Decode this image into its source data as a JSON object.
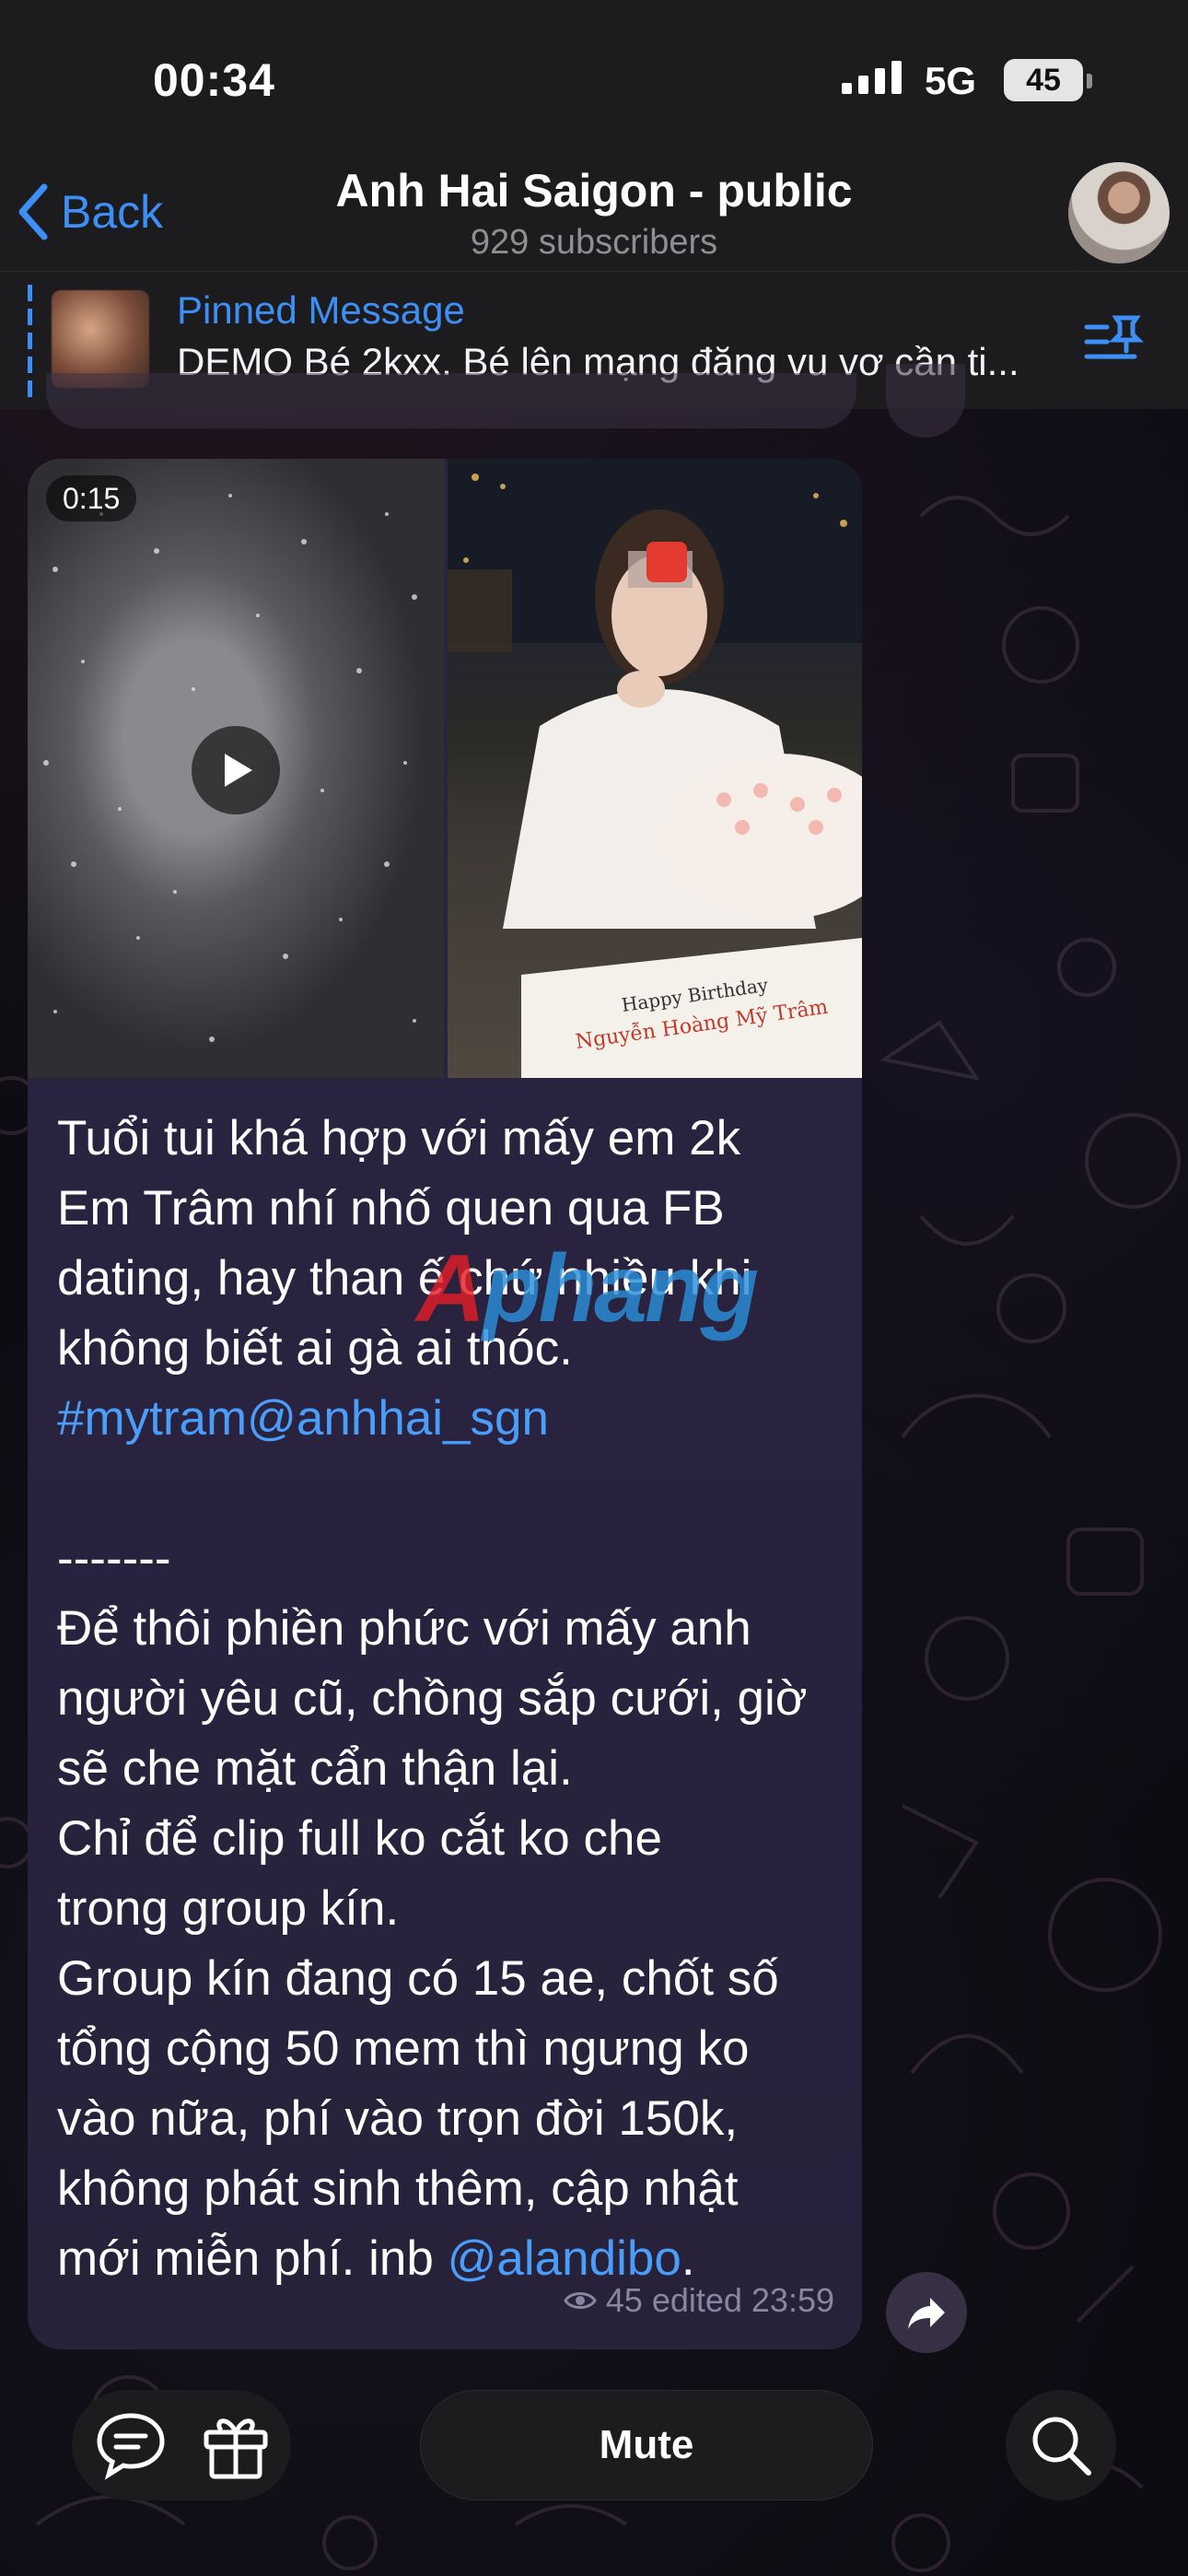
{
  "status_bar": {
    "time": "00:34",
    "network": "5G",
    "battery": "45"
  },
  "header": {
    "back_label": "Back",
    "title": "Anh Hai Saigon - public",
    "subtitle": "929 subscribers"
  },
  "pinned": {
    "title": "Pinned Message",
    "text": "DEMO Bé 2kxx. Bé lên mạng đăng vu vơ cần ti..."
  },
  "message": {
    "video_duration": "0:15",
    "text_lines": [
      "Tuổi tui khá hợp với mấy em 2k",
      "Em Trâm nhí nhố quen qua FB",
      "dating, hay than ế chứ nhiều khi",
      "không biết ai gà ai thóc."
    ],
    "hashtag": "#mytram@anhhai_sgn",
    "separator": "-------",
    "body_lines": [
      "Để thôi phiền phức với mấy anh",
      "người yêu cũ, chồng sắp cưới, giờ",
      "sẽ che mặt cẩn thận lại.",
      "Chỉ để clip full ko cắt ko che",
      "trong group kín.",
      "Group kín đang có 15 ae, chốt số",
      "tổng cộng 50 mem thì ngưng ko",
      "vào nữa, phí vào trọn đời 150k,",
      "không phát sinh thêm, cập nhật"
    ],
    "last_line_prefix": "mới miễn phí. inb ",
    "mention": "@alandibo",
    "last_line_suffix": ".",
    "views": "45",
    "edited_time": "edited 23:59",
    "cake_text_1": "Happy Birthday",
    "cake_text_2": "Nguyễn Hoàng Mỹ Trâm"
  },
  "watermark": {
    "part_a": "A",
    "part_b": "phang"
  },
  "bottom_bar": {
    "mute_label": "Mute"
  },
  "colors": {
    "accent": "#3d8ef5",
    "link": "#4a9df8",
    "bubble": "#2b2540",
    "bar": "#1c1c1e"
  },
  "icons": [
    "back-chevron-icon",
    "pin-list-icon",
    "play-icon",
    "eye-icon",
    "forward-icon",
    "comments-icon",
    "gift-icon",
    "search-icon",
    "signal-icon"
  ]
}
